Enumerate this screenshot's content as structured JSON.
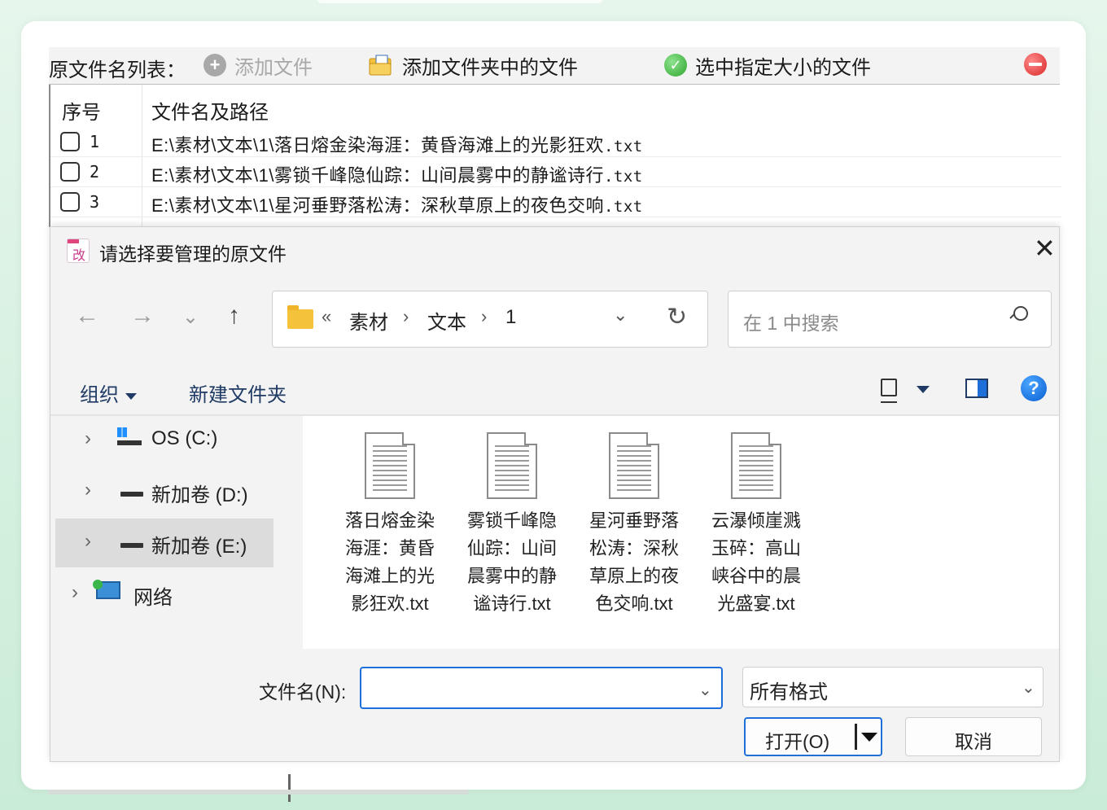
{
  "toolbar": {
    "label": "原文件名列表：",
    "add_file": "添加文件",
    "add_folder": "添加文件夹中的文件",
    "select_by_size": "选中指定大小的文件"
  },
  "table": {
    "headers": [
      "序号",
      "文件名及路径"
    ],
    "rows": [
      {
        "num": "1",
        "path": "E:\\素材\\文本\\1\\落日熔金染海涯：黄昏海滩上的光影狂欢",
        "ext": ".txt"
      },
      {
        "num": "2",
        "path": "E:\\素材\\文本\\1\\雾锁千峰隐仙踪：山间晨雾中的静谧诗行",
        "ext": ".txt"
      },
      {
        "num": "3",
        "path": "E:\\素材\\文本\\1\\星河垂野落松涛：深秋草原上的夜色交响",
        "ext": ".txt"
      }
    ]
  },
  "dialog": {
    "title": "请选择要管理的原文件",
    "app_icon_glyph": "改",
    "close": "✕",
    "nav": {
      "back": "←",
      "forward": "→",
      "recent": "⌄",
      "up": "↑"
    },
    "breadcrumb": {
      "overflow": "«",
      "items": [
        "素材",
        "文本",
        "1"
      ],
      "sep": "›"
    },
    "refresh": "↻",
    "search_placeholder": "在 1 中搜索",
    "commands": {
      "organize": "组织",
      "new_folder": "新建文件夹",
      "help": "?"
    },
    "tree": [
      {
        "label": "OS (C:)",
        "icon": "os-drive-icon",
        "selected": false
      },
      {
        "label": "新加卷 (D:)",
        "icon": "drive-icon",
        "selected": false
      },
      {
        "label": "新加卷 (E:)",
        "icon": "drive-icon",
        "selected": true
      },
      {
        "label": "网络",
        "icon": "network-icon",
        "selected": false
      }
    ],
    "tree_arrow": "›",
    "files": [
      {
        "name": "落日熔金染海涯：黄昏海滩上的光影狂欢.txt"
      },
      {
        "name": "雾锁千峰隐仙踪：山间晨雾中的静谧诗行.txt"
      },
      {
        "name": "星河垂野落松涛：深秋草原上的夜色交响.txt"
      },
      {
        "name": "云瀑倾崖溅玉碎：高山峡谷中的晨光盛宴.txt"
      }
    ],
    "filename_label": "文件名(N):",
    "filename_value": "",
    "dropdown_glyph": "⌄",
    "file_type": "所有格式",
    "open_button": "打开(O)",
    "cancel_button": "取消"
  },
  "colors": {
    "accent": "#1e6fd9",
    "background": "#d4f0df"
  }
}
